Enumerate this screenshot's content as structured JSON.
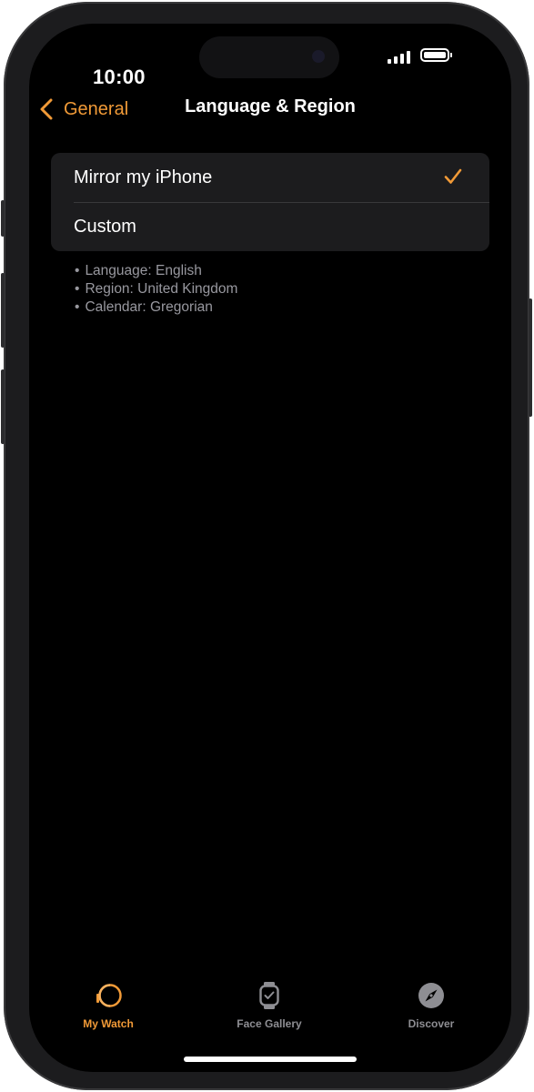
{
  "colors": {
    "accent": "#f19a37",
    "background": "#000000",
    "group_background": "#1c1c1e",
    "secondary_text": "#98989f",
    "inactive_tab": "#8e8e93"
  },
  "status_bar": {
    "time": "10:00"
  },
  "nav": {
    "back_label": "General",
    "title": "Language & Region"
  },
  "options": [
    {
      "label": "Mirror my iPhone",
      "selected": true
    },
    {
      "label": "Custom",
      "selected": false
    }
  ],
  "details": [
    "Language: English",
    "Region: United Kingdom",
    "Calendar: Gregorian"
  ],
  "tabs": [
    {
      "label": "My Watch",
      "icon": "watch-icon",
      "active": true
    },
    {
      "label": "Face Gallery",
      "icon": "watch-face-icon",
      "active": false
    },
    {
      "label": "Discover",
      "icon": "compass-icon",
      "active": false
    }
  ]
}
